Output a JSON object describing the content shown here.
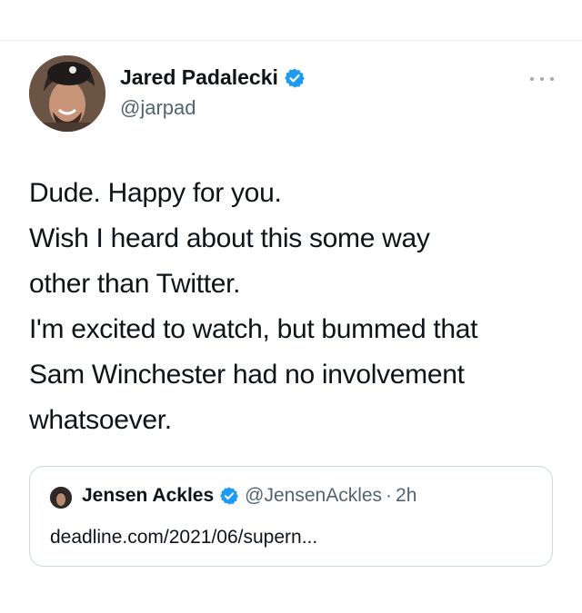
{
  "tweet": {
    "author": {
      "name": "Jared Padalecki",
      "handle": "@jarpad",
      "verified": true
    },
    "text_lines": [
      "Dude. Happy for you.",
      "Wish I heard about this some way",
      "other than Twitter.",
      "I'm excited to watch, but bummed that",
      "Sam Winchester had no involvement",
      "whatsoever."
    ],
    "more_icon": "ellipsis-icon"
  },
  "quoted_tweet": {
    "author_name": "Jensen Ackles",
    "handle": "@JensenAckles",
    "separator": "·",
    "time": "2h",
    "verified": true,
    "text": "deadline.com/2021/06/supern..."
  },
  "colors": {
    "verified_blue": "#1d9bf0",
    "secondary_text": "#536471",
    "border": "#cfd9de"
  }
}
